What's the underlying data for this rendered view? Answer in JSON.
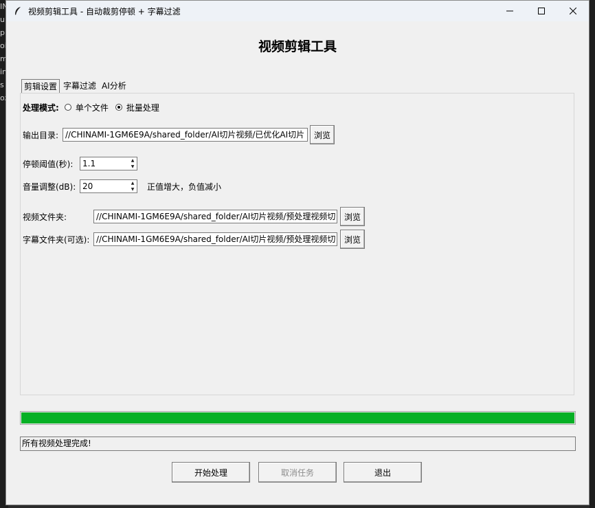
{
  "window": {
    "title": "视频剪辑工具 - 自动裁剪停顿 + 字幕过滤",
    "controls": {
      "minimize": "—",
      "maximize": "☐",
      "close": "✕"
    }
  },
  "background": {
    "left_chars": [
      "IN",
      "u",
      "p",
      "oi",
      "m",
      "in",
      "s",
      "oz"
    ]
  },
  "header": {
    "title": "视频剪辑工具"
  },
  "tabs": [
    {
      "label": "剪辑设置",
      "active": true
    },
    {
      "label": "字幕过滤",
      "active": false
    },
    {
      "label": "AI分析",
      "active": false
    }
  ],
  "mode": {
    "label": "处理模式:",
    "options": [
      {
        "label": "单个文件",
        "selected": false
      },
      {
        "label": "批量处理",
        "selected": true
      }
    ]
  },
  "output": {
    "label": "输出目录:",
    "value": "//CHINAMI-1GM6E9A/shared_folder/AI切片视频/已优化AI切片",
    "browse": "浏览"
  },
  "pause": {
    "label": "停顿阈值(秒):",
    "value": "1.1"
  },
  "volume": {
    "label": "音量调整(dB):",
    "value": "20",
    "hint": "正值增大，负值减小"
  },
  "video_folder": {
    "label": "视频文件夹:",
    "value": "//CHINAMI-1GM6E9A/shared_folder/AI切片视频/预处理视频切",
    "browse": "浏览"
  },
  "subtitle_folder": {
    "label": "字幕文件夹(可选):",
    "value": "//CHINAMI-1GM6E9A/shared_folder/AI切片视频/预处理视频切",
    "browse": "浏览"
  },
  "progress": {
    "percent": 100,
    "color": "#06b025"
  },
  "status": {
    "text": "所有视频处理完成!"
  },
  "buttons": {
    "start": "开始处理",
    "cancel": "取消任务",
    "exit": "退出"
  }
}
